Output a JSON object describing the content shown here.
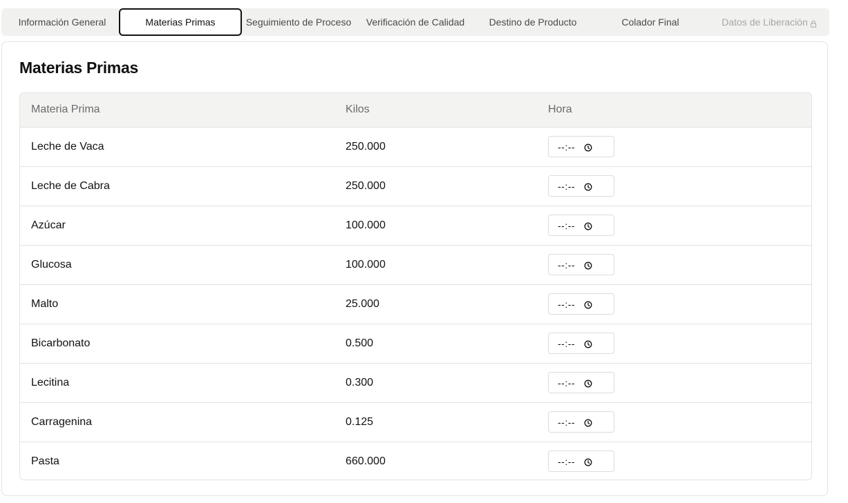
{
  "tabs": [
    {
      "label": "Información General",
      "state": "default"
    },
    {
      "label": "Materias Primas",
      "state": "active"
    },
    {
      "label": "Seguimiento de Proceso",
      "state": "default"
    },
    {
      "label": "Verificación de Calidad",
      "state": "default"
    },
    {
      "label": "Destino de Producto",
      "state": "default"
    },
    {
      "label": "Colador Final",
      "state": "default"
    },
    {
      "label": "Datos de Liberación",
      "state": "disabled",
      "icon": "lock-icon"
    }
  ],
  "section": {
    "title": "Materias Primas"
  },
  "table": {
    "headers": {
      "material": "Materia Prima",
      "kilos": "Kilos",
      "hora": "Hora"
    },
    "time_placeholder": "--:--",
    "time_icon": "clock-icon",
    "rows": [
      {
        "material": "Leche de Vaca",
        "kilos": "250.000"
      },
      {
        "material": "Leche de Cabra",
        "kilos": "250.000"
      },
      {
        "material": "Azúcar",
        "kilos": "100.000"
      },
      {
        "material": "Glucosa",
        "kilos": "100.000"
      },
      {
        "material": "Malto",
        "kilos": "25.000"
      },
      {
        "material": "Bicarbonato",
        "kilos": "0.500"
      },
      {
        "material": "Lecitina",
        "kilos": "0.300"
      },
      {
        "material": "Carragenina",
        "kilos": "0.125"
      },
      {
        "material": "Pasta",
        "kilos": "660.000"
      }
    ]
  }
}
